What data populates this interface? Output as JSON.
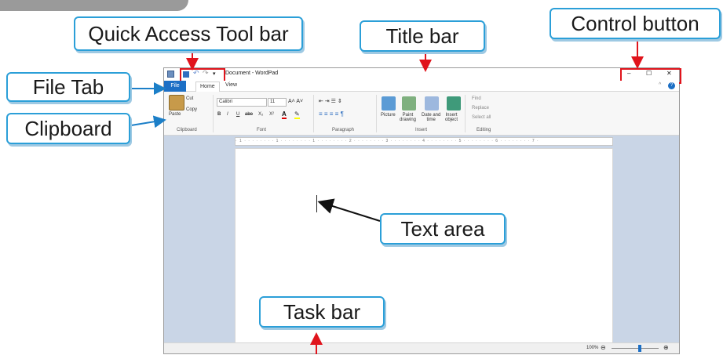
{
  "labels": {
    "quick_access": "Quick Access Tool bar",
    "title_bar": "Title bar",
    "control_button": "Control button",
    "file_tab": "File Tab",
    "clipboard": "Clipboard",
    "text_area": "Text area",
    "task_bar": "Task bar"
  },
  "window": {
    "title": "Document - WordPad",
    "tabs": {
      "file": "File",
      "home": "Home",
      "view": "View"
    },
    "controls": {
      "minimize": "–",
      "maximize": "☐",
      "close": "✕"
    }
  },
  "ribbon": {
    "clipboard": {
      "paste": "Paste",
      "cut": "Cut",
      "copy": "Copy",
      "group": "Clipboard"
    },
    "font": {
      "family": "Calibri",
      "size": "11",
      "bold": "B",
      "italic": "I",
      "underline": "U",
      "strike": "abe",
      "subscript": "X₂",
      "superscript": "X²",
      "group": "Font"
    },
    "paragraph": {
      "group": "Paragraph"
    },
    "insert": {
      "picture": "Picture",
      "paint": "Paint\ndrawing",
      "datetime": "Date and\ntime",
      "object": "Insert\nobject",
      "group": "Insert"
    },
    "editing": {
      "find": "Find",
      "replace": "Replace",
      "select_all": "Select all",
      "group": "Editing"
    }
  },
  "ruler": "· 1 · · · · · · · · 1 · · · · · · · · 1 · · · · · · · · 2 · · · · · · · · 3 · · · · · · · · 4 · · · · · · · · 5 · · · · · · · · 6 · · · · · · · · 7 ·",
  "status": {
    "zoom": "100%"
  },
  "colors": {
    "callout_border": "#2b9fd8",
    "highlight": "#e0141c",
    "file_tab": "#1c6fc5"
  }
}
